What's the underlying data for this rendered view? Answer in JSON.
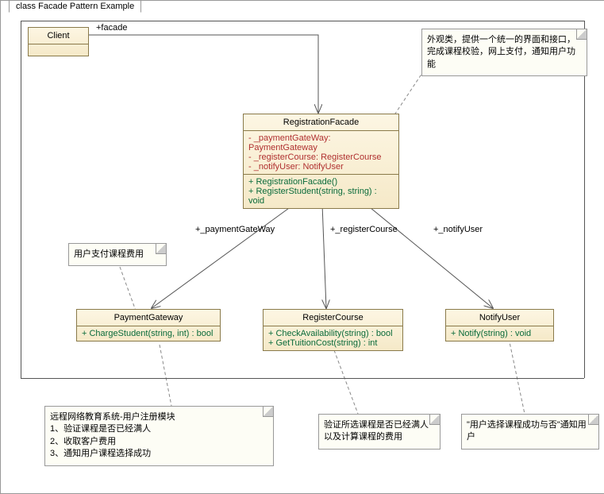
{
  "title": "class Facade Pattern Example",
  "assocFacade": "+facade",
  "assocPay": "+_paymentGateWay",
  "assocReg": "+_registerCourse",
  "assocNotify": "+_notifyUser",
  "client": {
    "name": "Client"
  },
  "facade": {
    "name": "RegistrationFacade",
    "a1": "-   _paymentGateWay: PaymentGateway",
    "a2": "-   _registerCourse: RegisterCourse",
    "a3": "-   _notifyUser: NotifyUser",
    "m1": "+   RegistrationFacade()",
    "m2": "+   RegisterStudent(string, string) : void"
  },
  "pay": {
    "name": "PaymentGateway",
    "m1": "+   ChargeStudent(string, int) : bool"
  },
  "reg": {
    "name": "RegisterCourse",
    "m1": "+   CheckAvailability(string) : bool",
    "m2": "+   GetTuitionCost(string) : int"
  },
  "notify": {
    "name": "NotifyUser",
    "m1": "+   Notify(string) : void"
  },
  "note1": "外观类，提供一个统一的界面和接口，完成课程校验，网上支付，通知用户功能",
  "note2": "用户支付课程费用",
  "note3": {
    "t": "远程网络教育系统-用户注册模块",
    "l1": "1、验证课程是否已经满人",
    "l2": "2、收取客户费用",
    "l3": "3、通知用户课程选择成功"
  },
  "note4": "验证所选课程是否已经满人以及计算课程的费用",
  "note5": "\"用户选择课程成功与否\"通知用户"
}
